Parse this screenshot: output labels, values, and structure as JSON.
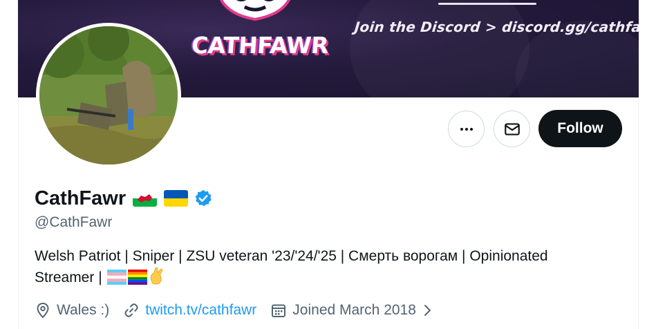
{
  "banner": {
    "brand_text": "CATHFAWR",
    "discord_text": "Join the Discord > discord.gg/cathfawr"
  },
  "profile": {
    "display_name": "CathFawr",
    "handle": "@CathFawr",
    "flags": [
      "wales-flag",
      "ukraine-flag"
    ],
    "verified": true,
    "verified_color": "#1d9bf0",
    "bio_line1": "Welsh Patriot | Sniper | ZSU veteran '23/'24/'25 | Смерть ворогам | Opinionated",
    "bio_line2": "Streamer | ",
    "bio_emojis": [
      "transgender-flag",
      "rainbow-flag",
      "pinching-hand"
    ]
  },
  "actions": {
    "more_icon": "more-icon",
    "message_icon": "mail-icon",
    "follow_label": "Follow"
  },
  "meta": {
    "location": "Wales :)",
    "website": "twitch.tv/cathfawr",
    "joined": "Joined March 2018"
  },
  "colors": {
    "link": "#1d9bf0",
    "secondary_text": "#536471",
    "follow_bg": "#0f1419"
  }
}
